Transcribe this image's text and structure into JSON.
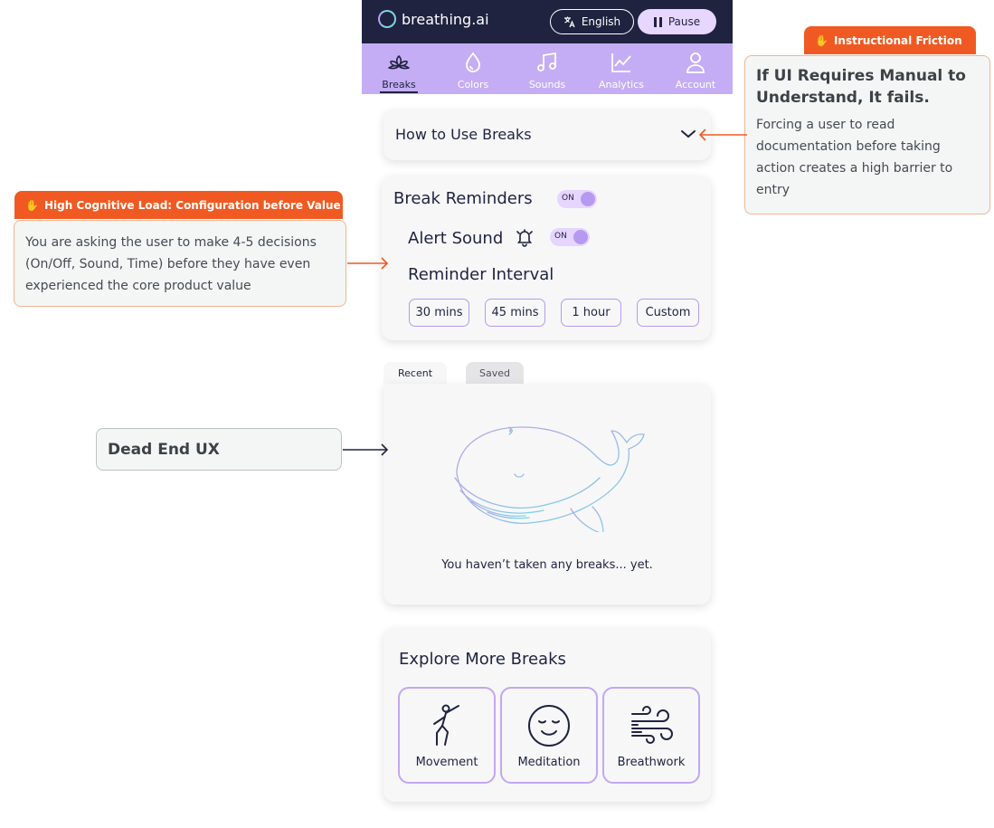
{
  "app": {
    "logo_text": "breathing.ai",
    "language_label": "English",
    "pause_label": "Pause"
  },
  "nav": {
    "items": [
      {
        "label": "Breaks",
        "icon": "lotus-icon",
        "active": true
      },
      {
        "label": "Colors",
        "icon": "droplet-icon",
        "active": false
      },
      {
        "label": "Sounds",
        "icon": "music-note-icon",
        "active": false
      },
      {
        "label": "Analytics",
        "icon": "line-chart-icon",
        "active": false
      },
      {
        "label": "Account",
        "icon": "user-icon",
        "active": false
      }
    ]
  },
  "how_to": {
    "title": "How to Use Breaks"
  },
  "reminders": {
    "title": "Break Reminders",
    "toggle_label": "ON",
    "alert_label": "Alert Sound",
    "alert_toggle_label": "ON",
    "interval_label": "Reminder Interval",
    "options": [
      "30 mins",
      "45 mins",
      "1 hour",
      "Custom"
    ]
  },
  "history": {
    "tabs": [
      "Recent",
      "Saved"
    ],
    "active_tab": "Recent",
    "empty_message": "You haven’t taken any breaks... yet."
  },
  "explore": {
    "title": "Explore More Breaks",
    "tiles": [
      {
        "label": "Movement",
        "icon": "person-stretching-icon"
      },
      {
        "label": "Meditation",
        "icon": "calm-face-icon"
      },
      {
        "label": "Breathwork",
        "icon": "wind-icon"
      }
    ]
  },
  "annotations": {
    "instructional": {
      "tag": "Instructional Friction",
      "title": "If UI Requires Manual to Understand, It fails.",
      "body": "Forcing a user to read documentation before taking action creates a high barrier to entry"
    },
    "cognitive": {
      "tag": "High Cognitive Load: Configuration before Value",
      "body": "You are asking the user to make 4-5 decisions (On/Off, Sound, Time) before they have even experienced the core product value"
    },
    "dead_end": {
      "title": "Dead End UX"
    }
  },
  "colors": {
    "navy": "#1f2340",
    "lavender_nav": "#c5adf5",
    "accent_orange": "#f05a22",
    "tile_border": "#c1a7f5"
  }
}
